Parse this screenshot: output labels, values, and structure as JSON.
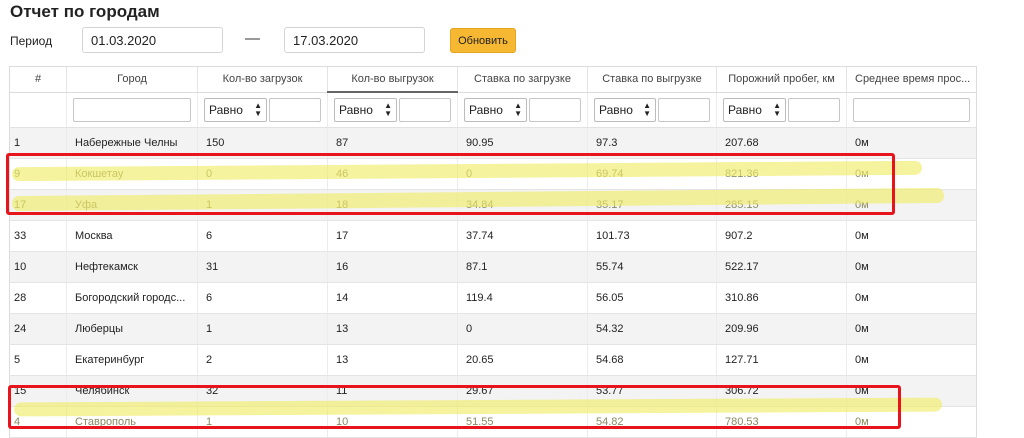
{
  "header": {
    "title": "Отчет по городам"
  },
  "period": {
    "label": "Период",
    "from": "01.03.2020",
    "separator": "—",
    "to": "17.03.2020",
    "refresh_label": "Обновить"
  },
  "table": {
    "columns": [
      "#",
      "Город",
      "Кол-во загрузок",
      "Кол-во выгрузок",
      "Ставка по загрузке",
      "Ставка по выгрузке",
      "Порожний пробег, км",
      "Среднее время прос..."
    ],
    "filter_operator": "Равно",
    "rows": [
      [
        "1",
        "Набережные Челны",
        "150",
        "87",
        "90.95",
        "97.3",
        "207.68",
        "0м"
      ],
      [
        "9",
        "Кокшетау",
        "0",
        "46",
        "0",
        "69.74",
        "821.36",
        "0м"
      ],
      [
        "17",
        "Уфа",
        "1",
        "18",
        "34.84",
        "35.17",
        "285.15",
        "0м"
      ],
      [
        "33",
        "Москва",
        "6",
        "17",
        "37.74",
        "101.73",
        "907.2",
        "0м"
      ],
      [
        "10",
        "Нефтекамск",
        "31",
        "16",
        "87.1",
        "55.74",
        "522.17",
        "0м"
      ],
      [
        "28",
        "Богородский городс...",
        "6",
        "14",
        "119.4",
        "56.05",
        "310.86",
        "0м"
      ],
      [
        "24",
        "Люберцы",
        "1",
        "13",
        "0",
        "54.32",
        "209.96",
        "0м"
      ],
      [
        "5",
        "Екатеринбург",
        "2",
        "13",
        "20.65",
        "54.68",
        "127.71",
        "0м"
      ],
      [
        "15",
        "Челябинск",
        "32",
        "11",
        "29.67",
        "53.77",
        "306.72",
        "0м"
      ],
      [
        "4",
        "Ставрополь",
        "1",
        "10",
        "51.55",
        "54.82",
        "780.53",
        "0м"
      ]
    ]
  },
  "annotations": {
    "highlight_color": "#f0ec64",
    "frame_color": "#e8141b"
  }
}
